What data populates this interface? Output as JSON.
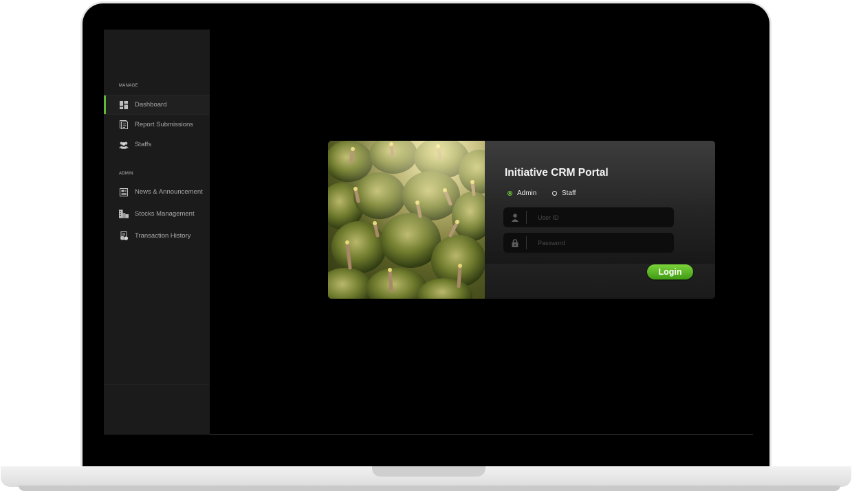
{
  "sidebar": {
    "sections": [
      {
        "label": "MANAGE",
        "items": [
          {
            "label": "Dashboard",
            "icon": "dashboard-icon",
            "active": true
          },
          {
            "label": "Report Submissions",
            "icon": "report-icon"
          },
          {
            "label": "Staffs",
            "icon": "users-icon"
          }
        ]
      },
      {
        "label": "ADMIN",
        "items": [
          {
            "label": "News & Announcement",
            "icon": "news-icon"
          },
          {
            "label": "Stocks Management",
            "icon": "stocks-icon"
          },
          {
            "label": "Transaction History",
            "icon": "transaction-icon"
          }
        ]
      }
    ]
  },
  "login": {
    "title": "Initiative CRM Portal",
    "roles": [
      {
        "label": "Admin",
        "checked": true
      },
      {
        "label": "Staff",
        "checked": false
      }
    ],
    "user_id_placeholder": "User ID",
    "password_placeholder": "Password",
    "login_label": "Login"
  },
  "colors": {
    "accent": "#5fb83a",
    "button_top": "#7bd33a",
    "button_bottom": "#3f9b14",
    "sidebar_bg": "#1b1b1b",
    "screen_bg": "#000000"
  }
}
